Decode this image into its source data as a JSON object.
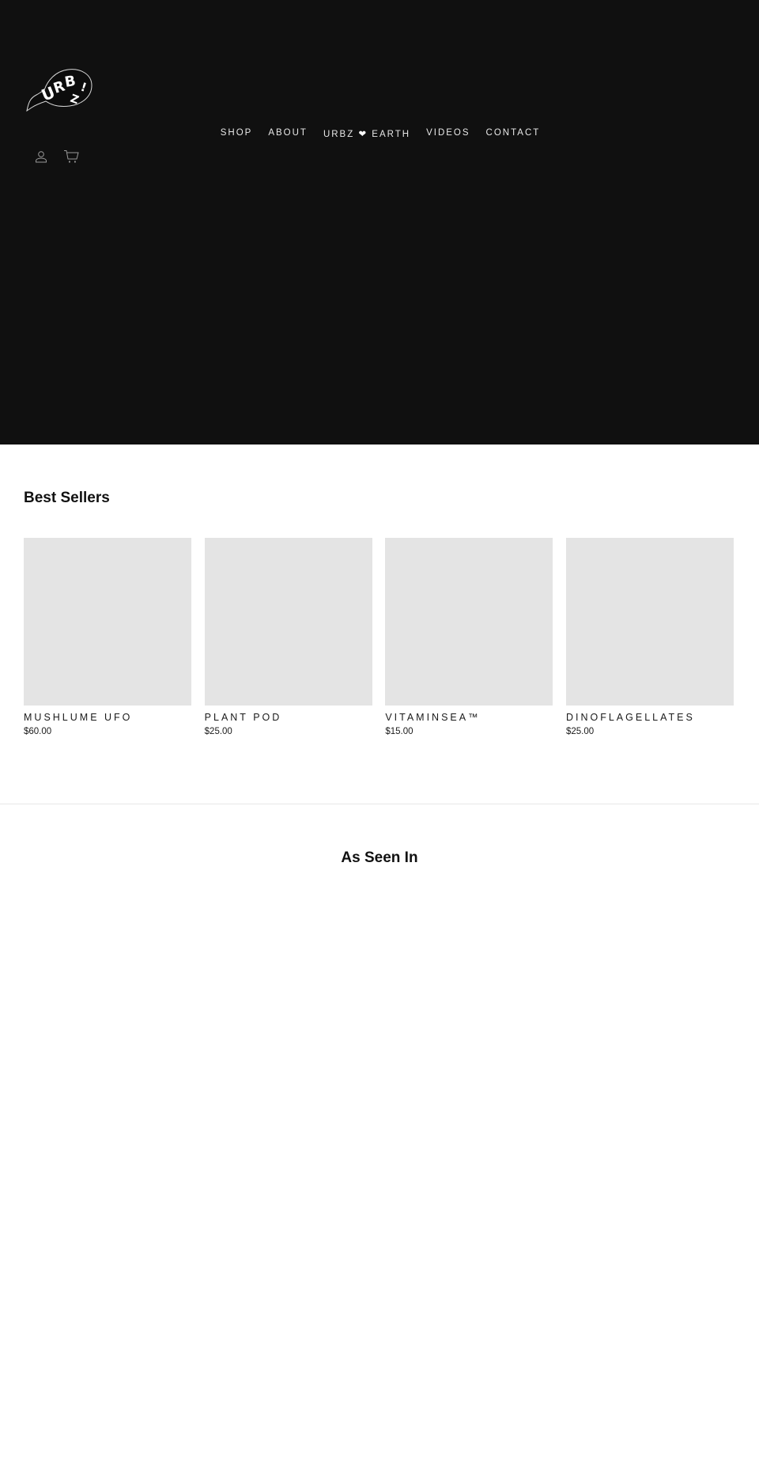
{
  "brand": {
    "name": "URBZ!",
    "logo_icon": "urbz-speech-bubble-logo"
  },
  "header": {
    "background_color": "#101010",
    "nav": [
      {
        "label": "SHOP"
      },
      {
        "label": "ABOUT"
      },
      {
        "label_prefix": "URBZ",
        "heart": "❤",
        "label_suffix": "EARTH"
      },
      {
        "label": "VIDEOS"
      },
      {
        "label": "CONTACT"
      }
    ],
    "icons": {
      "account": "user-icon",
      "cart": "cart-icon"
    }
  },
  "best_sellers": {
    "title": "Best Sellers",
    "products": [
      {
        "title": "MUSHLUME UFO",
        "price": "$60.00"
      },
      {
        "title": "PLANT POD",
        "price": "$25.00"
      },
      {
        "title": "VITAMINSEA™",
        "price": "$15.00"
      },
      {
        "title": "DINOFLAGELLATES",
        "price": "$25.00"
      }
    ],
    "image_placeholder_color": "#e4e4e4"
  },
  "as_seen_in": {
    "title": "As Seen In"
  }
}
